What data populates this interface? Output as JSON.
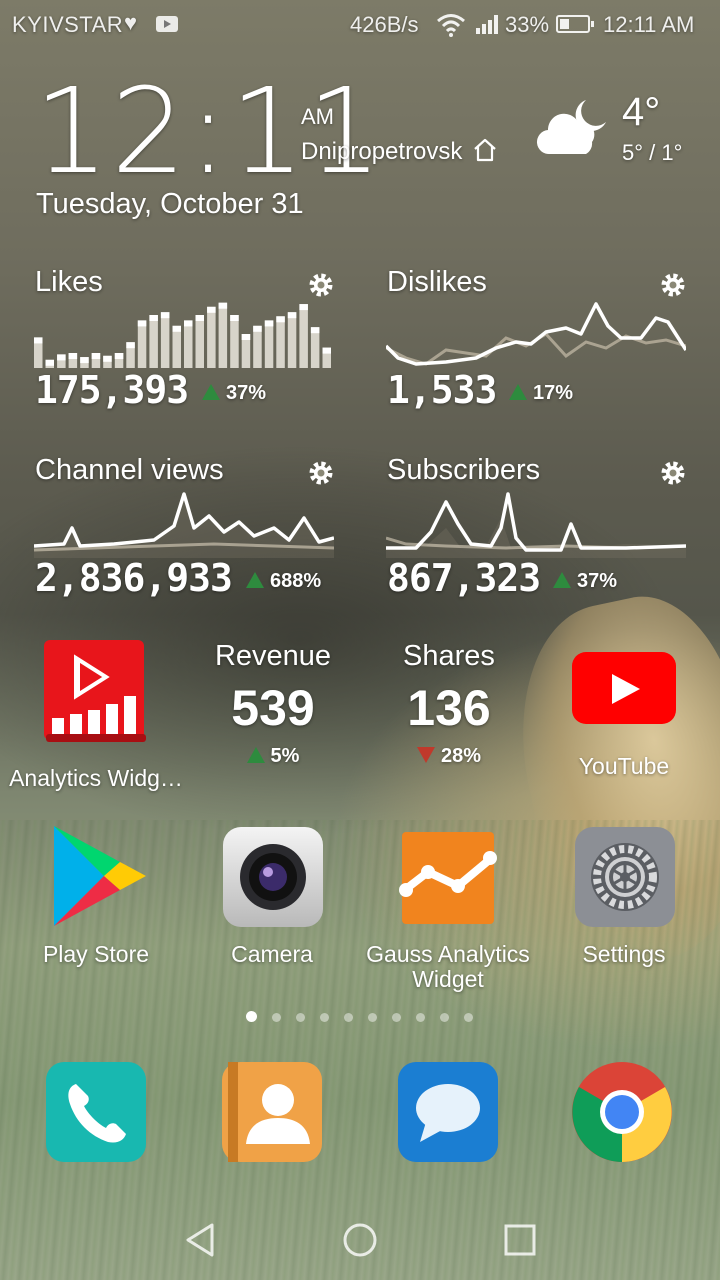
{
  "status_bar": {
    "carrier": "KYIVSTAR",
    "net_speed": "426B/s",
    "battery": "33%",
    "time": "12:11 AM"
  },
  "clock": {
    "time": "12:11",
    "ampm": "AM",
    "city": "Dnipropetrovsk",
    "date": "Tuesday, October 31",
    "temperature": "4°",
    "temp_range": "5° / 1°",
    "weather_icon": "partly-cloudy-night-icon"
  },
  "stats": {
    "likes": {
      "title": "Likes",
      "value": "175,393",
      "delta": "37%",
      "trend": "up",
      "bars": [
        0.45,
        0.12,
        0.2,
        0.22,
        0.16,
        0.22,
        0.18,
        0.22,
        0.38,
        0.7,
        0.78,
        0.82,
        0.62,
        0.7,
        0.78,
        0.9,
        0.96,
        0.78,
        0.5,
        0.62,
        0.7,
        0.76,
        0.82,
        0.94,
        0.6,
        0.3
      ]
    },
    "dislikes": {
      "title": "Dislikes",
      "value": "1,533",
      "delta": "17%",
      "trend": "up"
    },
    "channel_views": {
      "title": "Channel views",
      "value": "2,836,933",
      "delta": "688%",
      "trend": "up"
    },
    "subscribers": {
      "title": "Subscribers",
      "value": "867,323",
      "delta": "37%",
      "trend": "up"
    }
  },
  "mini_stats": {
    "revenue": {
      "title": "Revenue",
      "value": "539",
      "delta": "5%",
      "trend": "up"
    },
    "shares": {
      "title": "Shares",
      "value": "136",
      "delta": "28%",
      "trend": "down"
    }
  },
  "apps": {
    "analytics_widget": "Analytics Widg…",
    "youtube": "YouTube",
    "play_store": "Play Store",
    "camera": "Camera",
    "gauss": "Gauss Analytics Widget",
    "settings": "Settings"
  },
  "page_indicator": {
    "count": 10,
    "active": 1
  },
  "dock": [
    "phone-icon",
    "contacts-icon",
    "messages-icon",
    "chrome-icon"
  ],
  "colors": {
    "trend_up": "#2e8b3e",
    "trend_down": "#c0392b",
    "youtube_red": "#ff0000"
  }
}
